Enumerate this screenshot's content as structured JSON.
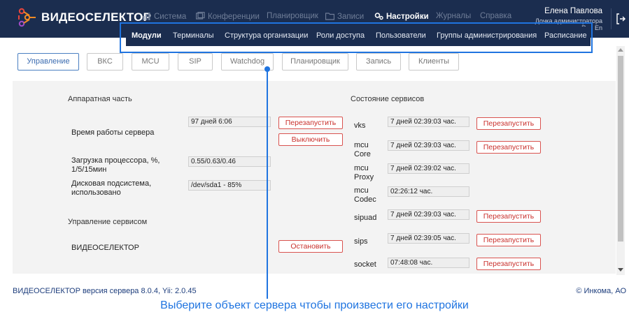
{
  "app": {
    "logo_text": "ВИДЕОСЕЛЕКТОР"
  },
  "topnav": [
    {
      "label": "Система",
      "icon": "chart-icon"
    },
    {
      "label": "Конференции",
      "icon": "video-icon"
    },
    {
      "label": "Планировщик",
      "icon": ""
    },
    {
      "label": "Записи",
      "icon": "folder-icon"
    },
    {
      "label": "Настройки",
      "icon": "gear-icon"
    },
    {
      "label": "Журналы",
      "icon": ""
    },
    {
      "label": "Справка",
      "icon": ""
    }
  ],
  "user": {
    "name": "Елена Павлова",
    "role": "Дочка администратора",
    "extra": "Ru | En"
  },
  "submenu": [
    {
      "label": "Модули"
    },
    {
      "label": "Терминалы"
    },
    {
      "label": "Структура организации"
    },
    {
      "label": "Роли доступа"
    },
    {
      "label": "Пользователи"
    },
    {
      "label": "Группы администрирования"
    },
    {
      "label": "Расписание"
    }
  ],
  "tabs": [
    {
      "label": "Управление"
    },
    {
      "label": "ВКС"
    },
    {
      "label": "MCU"
    },
    {
      "label": "SIP"
    },
    {
      "label": "Watchdog"
    },
    {
      "label": "Планировщик"
    },
    {
      "label": "Запись"
    },
    {
      "label": "Клиенты"
    }
  ],
  "hardware": {
    "title": "Аппаратная часть",
    "uptime_label": "Время работы сервера",
    "uptime_value": "97 дней 6:06",
    "restart_label": "Перезапустить",
    "shutdown_label": "Выключить",
    "cpu_label_1": "Загрузка процессора, %,",
    "cpu_label_2": "1/5/15мин",
    "cpu_value": "0.55/0.63/0.46",
    "disk_label_1": "Дисковая подсистема,",
    "disk_label_2": "использовано",
    "disk_value": "/dev/sda1 - 85%"
  },
  "service_mgmt": {
    "title": "Управление сервисом",
    "name": "ВИДЕОСЕЛЕКТОР",
    "stop_label": "Остановить"
  },
  "services": {
    "title": "Состояние сервисов",
    "restart_label": "Перезапустить",
    "items": [
      {
        "name_1": "vks",
        "name_2": "",
        "uptime": "7 дней 02:39:03 час."
      },
      {
        "name_1": "mcu",
        "name_2": "Core",
        "uptime": "7 дней 02:39:03 час."
      },
      {
        "name_1": "mcu",
        "name_2": "Proxy",
        "uptime": "7 дней 02:39:02 час."
      },
      {
        "name_1": "mcu",
        "name_2": "Codec",
        "uptime": "02:26:12 час."
      },
      {
        "name_1": "sipuad",
        "name_2": "",
        "uptime": "7 дней 02:39:03 час."
      },
      {
        "name_1": "sips",
        "name_2": "",
        "uptime": "7 дней 02:39:05 час."
      },
      {
        "name_1": "socket",
        "name_2": "",
        "uptime": "07:48:08 час."
      }
    ]
  },
  "footer": {
    "version": "ВИДЕОСЕЛЕКТОР версия сервера 8.0.4, Yii: 2.0.45",
    "copyright": "© Инкома, АО"
  },
  "caption": "Выберите объект сервера чтобы произвести его настройки",
  "colors": {
    "header_bg": "#1b2d4f",
    "accent": "#1f74e0",
    "danger": "#d9534f"
  }
}
